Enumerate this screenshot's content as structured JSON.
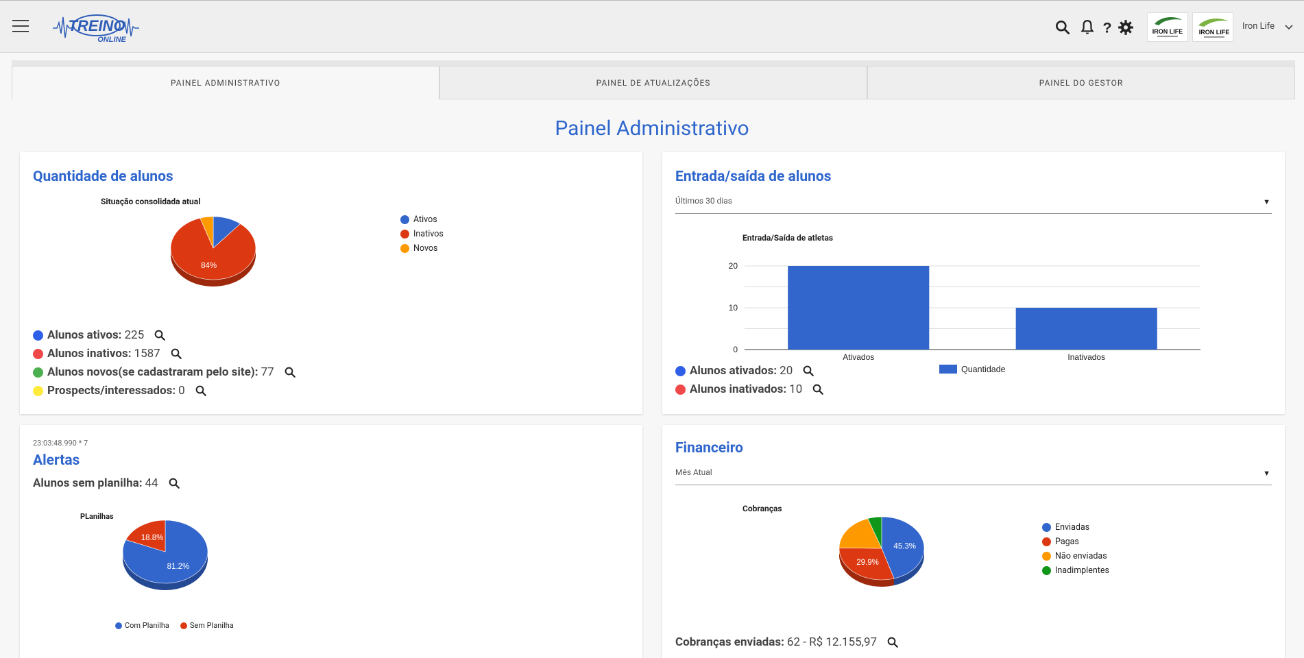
{
  "header": {
    "logo_text": "TREINO",
    "logo_sub": "ONLINE",
    "brand_label": "IRON LIFE",
    "user_name": "Iron Life",
    "icons": [
      "menu-icon",
      "search-icon",
      "bell-icon",
      "help-icon",
      "gear-icon",
      "chevron-down-icon"
    ]
  },
  "tabs": [
    {
      "label": "PAINEL ADMINISTRATIVO",
      "active": true
    },
    {
      "label": "PAINEL DE ATUALIZAÇÕES",
      "active": false
    },
    {
      "label": "PAINEL DO GESTOR",
      "active": false
    }
  ],
  "page_title": "Painel Administrativo",
  "alunos": {
    "title": "Quantidade de alunos",
    "chart_title": "Situação consolidada atual",
    "legend": [
      {
        "label": "Ativos",
        "color": "#3366cc"
      },
      {
        "label": "Inativos",
        "color": "#dc3912"
      },
      {
        "label": "Novos",
        "color": "#ff9900"
      }
    ],
    "slice_label": "84%",
    "stats": [
      {
        "label": "Alunos ativos:",
        "value": "225",
        "color": "#2f5ee8"
      },
      {
        "label": "Alunos inativos:",
        "value": "1587",
        "color": "#f04848"
      },
      {
        "label": "Alunos novos(se cadastraram pelo site):",
        "value": "77",
        "color": "#4caf50"
      },
      {
        "label": "Prospects/interessados:",
        "value": "0",
        "color": "#ffeb3b"
      }
    ]
  },
  "entrada": {
    "title": "Entrada/saída de alunos",
    "select_value": "Últimos 30 dias",
    "chart_title": "Entrada/Saída de atletas",
    "legend_label": "Quantidade",
    "stats": [
      {
        "label": "Alunos ativados:",
        "value": "20",
        "color": "#2f5ee8"
      },
      {
        "label": "Alunos inativados:",
        "value": "10",
        "color": "#f04848"
      }
    ]
  },
  "alertas": {
    "timestamp": "23:03:48.990 * 7",
    "title": "Alertas",
    "stat_label": "Alunos sem planilha:",
    "stat_value": "44",
    "chart_title": "PLanilhas",
    "legend": [
      {
        "label": "Com Planilha",
        "color": "#3366cc"
      },
      {
        "label": "Sem Planilha",
        "color": "#dc3912"
      }
    ]
  },
  "financeiro": {
    "title": "Financeiro",
    "select_value": "Mês Atual",
    "chart_title": "Cobranças",
    "legend": [
      {
        "label": "Enviadas",
        "color": "#3366cc"
      },
      {
        "label": "Pagas",
        "color": "#dc3912"
      },
      {
        "label": "Não enviadas",
        "color": "#ff9900"
      },
      {
        "label": "Inadimplentes",
        "color": "#109618"
      }
    ],
    "stat_label": "Cobranças enviadas:",
    "stat_value": "62 - R$ 12.155,97"
  },
  "chart_data": [
    {
      "type": "pie",
      "title": "Situação consolidada atual",
      "categories": [
        "Ativos",
        "Inativos",
        "Novos"
      ],
      "values": [
        11,
        84,
        5
      ],
      "data_labels": [
        "",
        "84%",
        ""
      ],
      "colors": [
        "#3366cc",
        "#dc3912",
        "#ff9900"
      ],
      "legend": "right"
    },
    {
      "type": "bar",
      "title": "Entrada/Saída de atletas",
      "categories": [
        "Ativados",
        "Inativados"
      ],
      "series": [
        {
          "name": "Quantidade",
          "values": [
            20,
            10
          ],
          "color": "#3366cc"
        }
      ],
      "yticks": [
        0,
        10,
        20
      ],
      "ylim": [
        0,
        20
      ],
      "grid": true,
      "legend": "bottom"
    },
    {
      "type": "pie",
      "title": "PLanilhas",
      "categories": [
        "Com Planilha",
        "Sem Planilha"
      ],
      "values": [
        81.2,
        18.8
      ],
      "data_labels": [
        "81.2%",
        "18.8%"
      ],
      "colors": [
        "#3366cc",
        "#dc3912"
      ],
      "legend": "bottom"
    },
    {
      "type": "pie",
      "title": "Cobranças",
      "categories": [
        "Enviadas",
        "Pagas",
        "Não enviadas",
        "Inadimplentes"
      ],
      "values": [
        45.3,
        29.9,
        19.5,
        5.3
      ],
      "data_labels": [
        "45.3%",
        "29.9%",
        "",
        ""
      ],
      "colors": [
        "#3366cc",
        "#dc3912",
        "#ff9900",
        "#109618"
      ],
      "legend": "right"
    }
  ]
}
